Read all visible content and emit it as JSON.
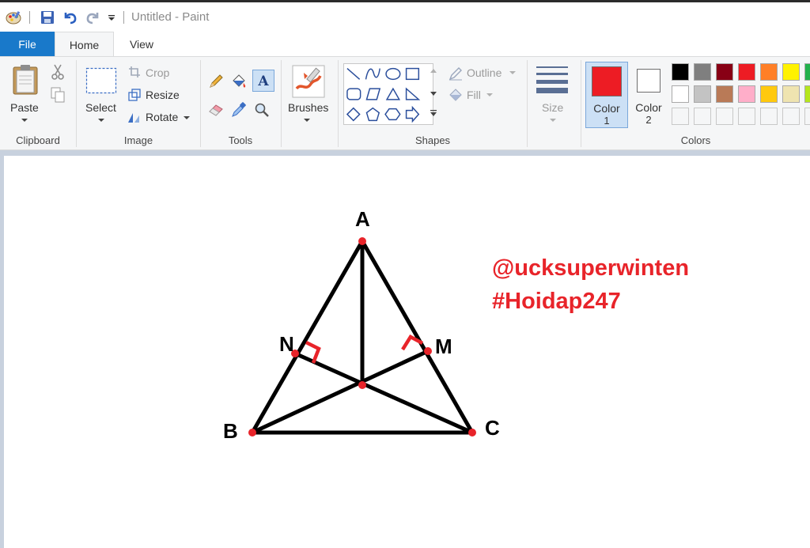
{
  "window": {
    "title": "Untitled - Paint"
  },
  "tabs": {
    "file": "File",
    "home": "Home",
    "view": "View"
  },
  "clipboard": {
    "paste": "Paste",
    "group": "Clipboard"
  },
  "image": {
    "select": "Select",
    "crop": "Crop",
    "resize": "Resize",
    "rotate": "Rotate",
    "group": "Image"
  },
  "tools": {
    "group": "Tools"
  },
  "brushes": {
    "label": "Brushes"
  },
  "shapes": {
    "outline": "Outline",
    "fill": "Fill",
    "group": "Shapes"
  },
  "size": {
    "label": "Size"
  },
  "colors": {
    "color1_label": "Color",
    "color1_num": "1",
    "color2_label": "Color",
    "color2_num": "2",
    "group": "Colors",
    "color1": "#ed1c24",
    "color2": "#ffffff",
    "palette_row1": [
      "#000000",
      "#7f7f7f",
      "#880015",
      "#ed1c24",
      "#ff7f27",
      "#fff200",
      "#22b14c"
    ],
    "palette_row2": [
      "#ffffff",
      "#c3c3c3",
      "#b97a57",
      "#ffaec9",
      "#ffc90e",
      "#efe4b0",
      "#b5e61d"
    ]
  },
  "drawing": {
    "labels": {
      "a": "A",
      "b": "B",
      "c": "C",
      "m": "M",
      "n": "N"
    },
    "watermark_line1": "@ucksuperwinten",
    "watermark_line2": "#Hoidap247"
  }
}
